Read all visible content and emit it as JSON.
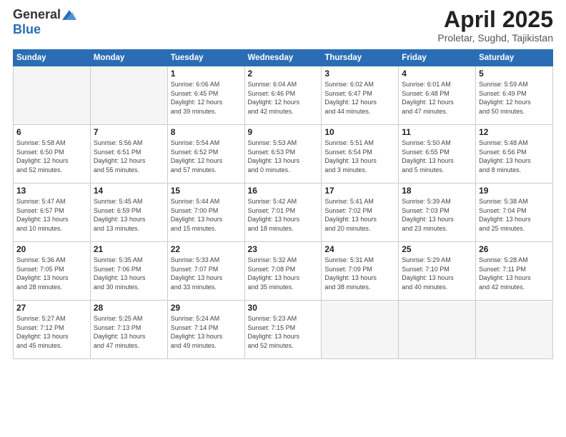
{
  "logo": {
    "general": "General",
    "blue": "Blue"
  },
  "header": {
    "month_title": "April 2025",
    "location": "Proletar, Sughd, Tajikistan"
  },
  "days_of_week": [
    "Sunday",
    "Monday",
    "Tuesday",
    "Wednesday",
    "Thursday",
    "Friday",
    "Saturday"
  ],
  "weeks": [
    [
      {
        "num": "",
        "detail": ""
      },
      {
        "num": "",
        "detail": ""
      },
      {
        "num": "1",
        "detail": "Sunrise: 6:06 AM\nSunset: 6:45 PM\nDaylight: 12 hours\nand 39 minutes."
      },
      {
        "num": "2",
        "detail": "Sunrise: 6:04 AM\nSunset: 6:46 PM\nDaylight: 12 hours\nand 42 minutes."
      },
      {
        "num": "3",
        "detail": "Sunrise: 6:02 AM\nSunset: 6:47 PM\nDaylight: 12 hours\nand 44 minutes."
      },
      {
        "num": "4",
        "detail": "Sunrise: 6:01 AM\nSunset: 6:48 PM\nDaylight: 12 hours\nand 47 minutes."
      },
      {
        "num": "5",
        "detail": "Sunrise: 5:59 AM\nSunset: 6:49 PM\nDaylight: 12 hours\nand 50 minutes."
      }
    ],
    [
      {
        "num": "6",
        "detail": "Sunrise: 5:58 AM\nSunset: 6:50 PM\nDaylight: 12 hours\nand 52 minutes."
      },
      {
        "num": "7",
        "detail": "Sunrise: 5:56 AM\nSunset: 6:51 PM\nDaylight: 12 hours\nand 55 minutes."
      },
      {
        "num": "8",
        "detail": "Sunrise: 5:54 AM\nSunset: 6:52 PM\nDaylight: 12 hours\nand 57 minutes."
      },
      {
        "num": "9",
        "detail": "Sunrise: 5:53 AM\nSunset: 6:53 PM\nDaylight: 13 hours\nand 0 minutes."
      },
      {
        "num": "10",
        "detail": "Sunrise: 5:51 AM\nSunset: 6:54 PM\nDaylight: 13 hours\nand 3 minutes."
      },
      {
        "num": "11",
        "detail": "Sunrise: 5:50 AM\nSunset: 6:55 PM\nDaylight: 13 hours\nand 5 minutes."
      },
      {
        "num": "12",
        "detail": "Sunrise: 5:48 AM\nSunset: 6:56 PM\nDaylight: 13 hours\nand 8 minutes."
      }
    ],
    [
      {
        "num": "13",
        "detail": "Sunrise: 5:47 AM\nSunset: 6:57 PM\nDaylight: 13 hours\nand 10 minutes."
      },
      {
        "num": "14",
        "detail": "Sunrise: 5:45 AM\nSunset: 6:59 PM\nDaylight: 13 hours\nand 13 minutes."
      },
      {
        "num": "15",
        "detail": "Sunrise: 5:44 AM\nSunset: 7:00 PM\nDaylight: 13 hours\nand 15 minutes."
      },
      {
        "num": "16",
        "detail": "Sunrise: 5:42 AM\nSunset: 7:01 PM\nDaylight: 13 hours\nand 18 minutes."
      },
      {
        "num": "17",
        "detail": "Sunrise: 5:41 AM\nSunset: 7:02 PM\nDaylight: 13 hours\nand 20 minutes."
      },
      {
        "num": "18",
        "detail": "Sunrise: 5:39 AM\nSunset: 7:03 PM\nDaylight: 13 hours\nand 23 minutes."
      },
      {
        "num": "19",
        "detail": "Sunrise: 5:38 AM\nSunset: 7:04 PM\nDaylight: 13 hours\nand 25 minutes."
      }
    ],
    [
      {
        "num": "20",
        "detail": "Sunrise: 5:36 AM\nSunset: 7:05 PM\nDaylight: 13 hours\nand 28 minutes."
      },
      {
        "num": "21",
        "detail": "Sunrise: 5:35 AM\nSunset: 7:06 PM\nDaylight: 13 hours\nand 30 minutes."
      },
      {
        "num": "22",
        "detail": "Sunrise: 5:33 AM\nSunset: 7:07 PM\nDaylight: 13 hours\nand 33 minutes."
      },
      {
        "num": "23",
        "detail": "Sunrise: 5:32 AM\nSunset: 7:08 PM\nDaylight: 13 hours\nand 35 minutes."
      },
      {
        "num": "24",
        "detail": "Sunrise: 5:31 AM\nSunset: 7:09 PM\nDaylight: 13 hours\nand 38 minutes."
      },
      {
        "num": "25",
        "detail": "Sunrise: 5:29 AM\nSunset: 7:10 PM\nDaylight: 13 hours\nand 40 minutes."
      },
      {
        "num": "26",
        "detail": "Sunrise: 5:28 AM\nSunset: 7:11 PM\nDaylight: 13 hours\nand 42 minutes."
      }
    ],
    [
      {
        "num": "27",
        "detail": "Sunrise: 5:27 AM\nSunset: 7:12 PM\nDaylight: 13 hours\nand 45 minutes."
      },
      {
        "num": "28",
        "detail": "Sunrise: 5:25 AM\nSunset: 7:13 PM\nDaylight: 13 hours\nand 47 minutes."
      },
      {
        "num": "29",
        "detail": "Sunrise: 5:24 AM\nSunset: 7:14 PM\nDaylight: 13 hours\nand 49 minutes."
      },
      {
        "num": "30",
        "detail": "Sunrise: 5:23 AM\nSunset: 7:15 PM\nDaylight: 13 hours\nand 52 minutes."
      },
      {
        "num": "",
        "detail": ""
      },
      {
        "num": "",
        "detail": ""
      },
      {
        "num": "",
        "detail": ""
      }
    ]
  ]
}
